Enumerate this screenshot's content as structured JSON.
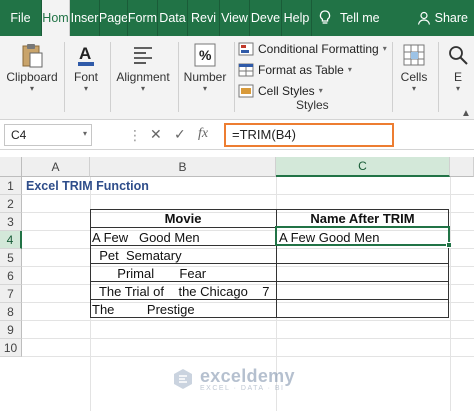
{
  "tabs": {
    "items": [
      "File",
      "Hom",
      "Inser",
      "Page",
      "Form",
      "Data",
      "Revi",
      "View",
      "Deve",
      "Help"
    ],
    "tell_me": "Tell me",
    "share": "Share"
  },
  "ribbon": {
    "clipboard": "Clipboard",
    "font": "Font",
    "alignment": "Alignment",
    "number": "Number",
    "number_symbol": "%",
    "conditional_formatting": "Conditional Formatting",
    "format_as_table": "Format as Table",
    "cell_styles": "Cell Styles",
    "styles": "Styles",
    "cells": "Cells",
    "editing": "E"
  },
  "formula_bar": {
    "name_box": "C4",
    "formula": "=TRIM(B4)",
    "fx": "fx"
  },
  "grid": {
    "columns": [
      "A",
      "B",
      "C"
    ],
    "rows": [
      "1",
      "2",
      "3",
      "4",
      "5",
      "6",
      "7",
      "8",
      "9",
      "10"
    ],
    "title": "Excel TRIM Function",
    "table_headers": [
      "Movie",
      "Name After TRIM"
    ],
    "movies": [
      "A Few   Good Men",
      "  Pet  Sematary",
      "       Primal       Fear",
      "  The Trial of    the Chicago    7",
      "The         Prestige"
    ],
    "trimmed": [
      "A Few Good Men",
      "",
      "",
      "",
      ""
    ]
  },
  "watermark": {
    "name": "exceldemy",
    "tagline": "EXCEL · DATA · BI"
  },
  "colors": {
    "excel_green": "#217346",
    "highlight_orange": "#ed7d31",
    "title_blue": "#2e4d8a"
  }
}
